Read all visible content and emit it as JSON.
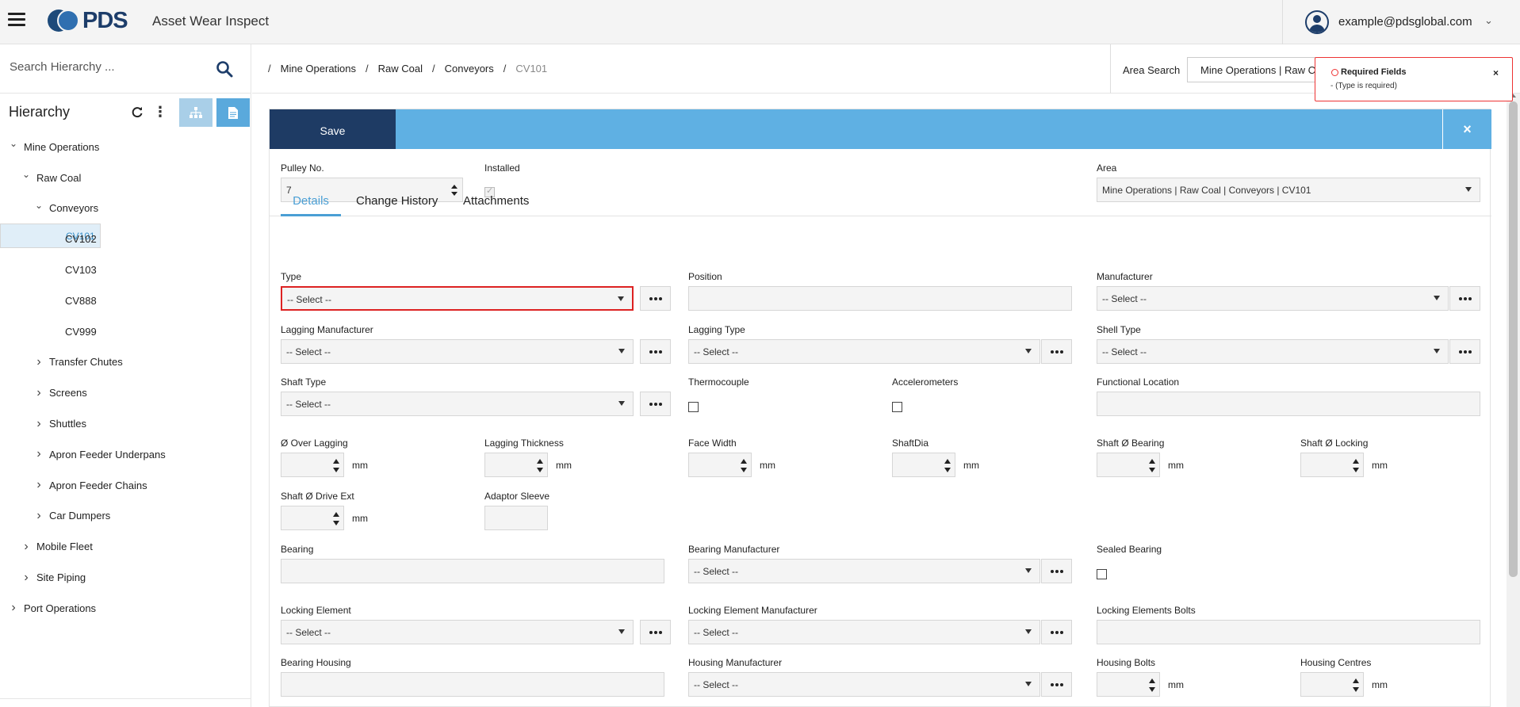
{
  "app": {
    "logo_text": "PDS",
    "title": "Asset Wear Inspect",
    "user_email": "example@pdsglobal.com"
  },
  "sidebar": {
    "search_placeholder": "Search Hierarchy ...",
    "hierarchy_title": "Hierarchy",
    "tree": [
      {
        "label": "Mine Operations",
        "level": 0,
        "state": "expanded"
      },
      {
        "label": "Raw Coal",
        "level": 1,
        "state": "expanded"
      },
      {
        "label": "Conveyors",
        "level": 2,
        "state": "expanded"
      },
      {
        "label": "CV101",
        "level": 3,
        "state": "leaf",
        "selected": true
      },
      {
        "label": "CV102",
        "level": 3,
        "state": "leaf"
      },
      {
        "label": "CV103",
        "level": 3,
        "state": "leaf"
      },
      {
        "label": "CV888",
        "level": 3,
        "state": "leaf"
      },
      {
        "label": "CV999",
        "level": 3,
        "state": "leaf"
      },
      {
        "label": "Transfer Chutes",
        "level": 2,
        "state": "collapsed"
      },
      {
        "label": "Screens",
        "level": 2,
        "state": "collapsed"
      },
      {
        "label": "Shuttles",
        "level": 2,
        "state": "collapsed"
      },
      {
        "label": "Apron Feeder Underpans",
        "level": 2,
        "state": "collapsed"
      },
      {
        "label": "Apron Feeder Chains",
        "level": 2,
        "state": "collapsed"
      },
      {
        "label": "Car Dumpers",
        "level": 2,
        "state": "collapsed"
      },
      {
        "label": "Mobile Fleet",
        "level": 1,
        "state": "collapsed"
      },
      {
        "label": "Site Piping",
        "level": 1,
        "state": "collapsed"
      },
      {
        "label": "Port Operations",
        "level": 0,
        "state": "collapsed"
      }
    ]
  },
  "breadcrumb": {
    "items": [
      "Mine Operations",
      "Raw Coal",
      "Conveyors"
    ],
    "current": "CV101"
  },
  "area_search": {
    "label": "Area Search",
    "value": "Mine Operations | Raw Coal | Conveyors | CV101"
  },
  "toast": {
    "title": "Required Fields",
    "message": "- (Type is required)",
    "close": "×"
  },
  "form": {
    "save_label": "Save",
    "close_label": "×",
    "pulley_no_label": "Pulley No.",
    "pulley_no_value": "7",
    "installed_label": "Installed",
    "installed_checked": true,
    "area_label": "Area",
    "area_value": "Mine Operations | Raw Coal | Conveyors | CV101",
    "tabs": [
      "Details",
      "Change History",
      "Attachments"
    ],
    "active_tab": "Details",
    "select_placeholder": "-- Select --",
    "labels": {
      "type": "Type",
      "position": "Position",
      "manufacturer": "Manufacturer",
      "lagging_manufacturer": "Lagging Manufacturer",
      "lagging_type": "Lagging Type",
      "shell_type": "Shell Type",
      "shaft_type": "Shaft Type",
      "thermocouple": "Thermocouple",
      "accelerometers": "Accelerometers",
      "functional_location": "Functional Location",
      "over_lagging": "Ø Over Lagging",
      "lagging_thickness": "Lagging Thickness",
      "face_width": "Face Width",
      "shaft_dia": "ShaftDia",
      "shaft_bearing": "Shaft Ø Bearing",
      "shaft_locking": "Shaft Ø Locking",
      "shaft_drive_ext": "Shaft Ø Drive Ext",
      "adaptor_sleeve": "Adaptor Sleeve",
      "bearing": "Bearing",
      "bearing_manufacturer": "Bearing Manufacturer",
      "sealed_bearing": "Sealed Bearing",
      "locking_element": "Locking Element",
      "locking_element_manufacturer": "Locking Element Manufacturer",
      "locking_elements_bolts": "Locking Elements Bolts",
      "bearing_housing": "Bearing Housing",
      "housing_manufacturer": "Housing Manufacturer",
      "housing_bolts": "Housing Bolts",
      "housing_centres": "Housing Centres"
    },
    "unit": "mm"
  },
  "colors": {
    "save_bar": "#5fb0e3",
    "save_button": "#1e3b64",
    "accent": "#4a9fd5",
    "error": "#d22222",
    "selected_row": "#e0eef8"
  }
}
